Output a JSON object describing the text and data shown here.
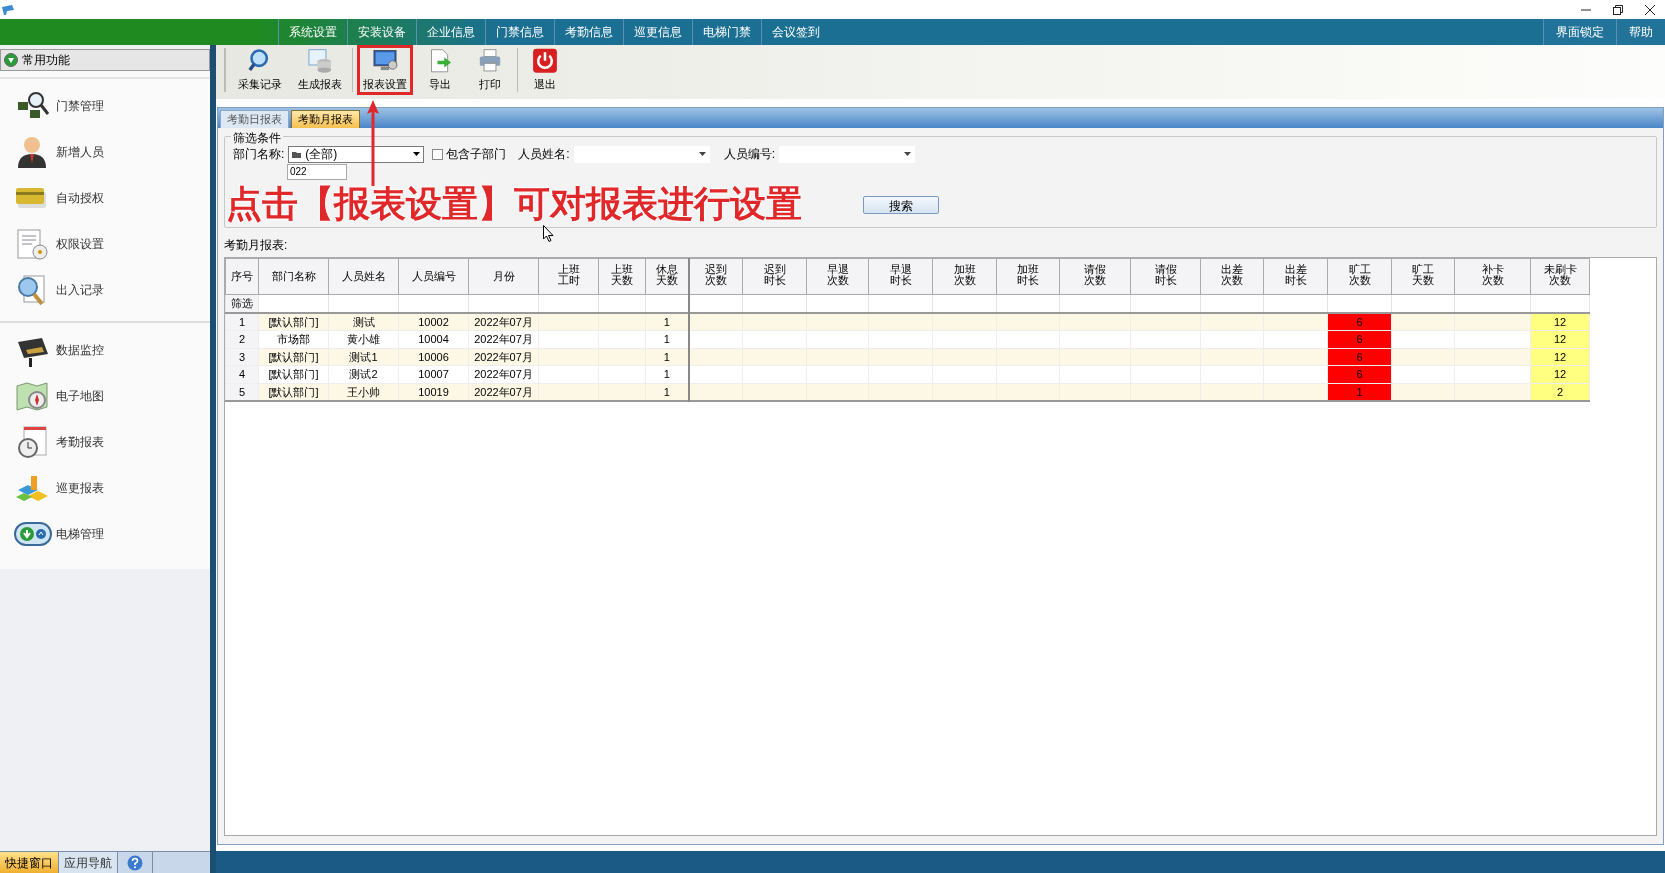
{
  "menu": [
    {
      "label": "系统设置"
    },
    {
      "label": "安装设备"
    },
    {
      "label": "企业信息"
    },
    {
      "label": "门禁信息"
    },
    {
      "label": "考勤信息"
    },
    {
      "label": "巡更信息"
    },
    {
      "label": "电梯门禁"
    },
    {
      "label": "会议签到"
    }
  ],
  "menu_right": [
    {
      "label": "界面锁定"
    },
    {
      "label": "帮助"
    }
  ],
  "sidebar": {
    "header": "常用功能",
    "groups": [
      {
        "items": [
          {
            "label": "门禁管理",
            "kind": "chips"
          },
          {
            "label": "新增人员",
            "kind": "person"
          },
          {
            "label": "自动授权",
            "kind": "card"
          },
          {
            "label": "权限设置",
            "kind": "doc"
          },
          {
            "label": "出入记录",
            "kind": "search"
          }
        ]
      },
      {
        "items": [
          {
            "label": "数据监控",
            "kind": "camera"
          },
          {
            "label": "电子地图",
            "kind": "map"
          },
          {
            "label": "考勤报表",
            "kind": "clock"
          },
          {
            "label": "巡更报表",
            "kind": "blocks"
          },
          {
            "label": "电梯管理",
            "kind": "elevator"
          }
        ]
      }
    ]
  },
  "bottom_tabs": [
    {
      "label": "快捷窗口",
      "selected": true
    },
    {
      "label": "应用导航",
      "selected": false
    }
  ],
  "toolbar": [
    {
      "label": "采集记录",
      "kind": "search",
      "highlighted": false
    },
    {
      "label": "生成报表",
      "kind": "db",
      "highlighted": false
    },
    {
      "label": "报表设置",
      "kind": "monitor",
      "highlighted": true
    },
    {
      "label": "导出",
      "kind": "export",
      "highlighted": false
    },
    {
      "label": "打印",
      "kind": "print",
      "highlighted": false
    },
    {
      "label": "退出",
      "kind": "power",
      "highlighted": false
    }
  ],
  "tabs": [
    {
      "label": "考勤日报表",
      "selected": false
    },
    {
      "label": "考勤月报表",
      "selected": true
    }
  ],
  "filter": {
    "title": "筛选条件",
    "dept_label": "部门名称:",
    "dept_value": "(全部)",
    "include_sub": {
      "label": "包含子部门",
      "checked": false
    },
    "name_label": "人员姓名:",
    "id_label": "人员编号:",
    "date_fragment": "022",
    "search_button": "搜索"
  },
  "annotation": "点击【报表设置】可对报表进行设置",
  "table": {
    "title": "考勤月报表:",
    "filter_row_label": "筛选",
    "columns": [
      {
        "label": "序号"
      },
      {
        "label": "部门名称"
      },
      {
        "label": "人员姓名"
      },
      {
        "label": "人员编号"
      },
      {
        "label": "月份"
      },
      {
        "label": "上班工时"
      },
      {
        "label": "上班天数"
      },
      {
        "label": "休息天数"
      },
      {
        "label": "迟到次数"
      },
      {
        "label": "迟到时长"
      },
      {
        "label": "早退次数"
      },
      {
        "label": "早退时长"
      },
      {
        "label": "加班次数"
      },
      {
        "label": "加班时长"
      },
      {
        "label": "请假次数"
      },
      {
        "label": "请假时长"
      },
      {
        "label": "出差次数"
      },
      {
        "label": "出差时长"
      },
      {
        "label": "旷工次数",
        "color": "#ff0000"
      },
      {
        "label": "旷工天数"
      },
      {
        "label": "补卡次数"
      },
      {
        "label": "未刷卡次数",
        "color": "#ffff80"
      }
    ],
    "rows": [
      {
        "index": "1",
        "dept": "[默认部门]",
        "name": "测试",
        "id": "10002",
        "month": "2022年07月",
        "rest": "1",
        "absent": "6",
        "unswiped": "12"
      },
      {
        "index": "2",
        "dept": "市场部",
        "name": "黄小雄",
        "id": "10004",
        "month": "2022年07月",
        "rest": "1",
        "absent": "6",
        "unswiped": "12"
      },
      {
        "index": "3",
        "dept": "[默认部门]",
        "name": "测试1",
        "id": "10006",
        "month": "2022年07月",
        "rest": "1",
        "absent": "6",
        "unswiped": "12"
      },
      {
        "index": "4",
        "dept": "[默认部门]",
        "name": "测试2",
        "id": "10007",
        "month": "2022年07月",
        "rest": "1",
        "absent": "6",
        "unswiped": "12"
      },
      {
        "index": "5",
        "dept": "[默认部门]",
        "name": "王小帅",
        "id": "10019",
        "month": "2022年07月",
        "rest": "1",
        "absent": "1",
        "unswiped": "2"
      }
    ]
  }
}
